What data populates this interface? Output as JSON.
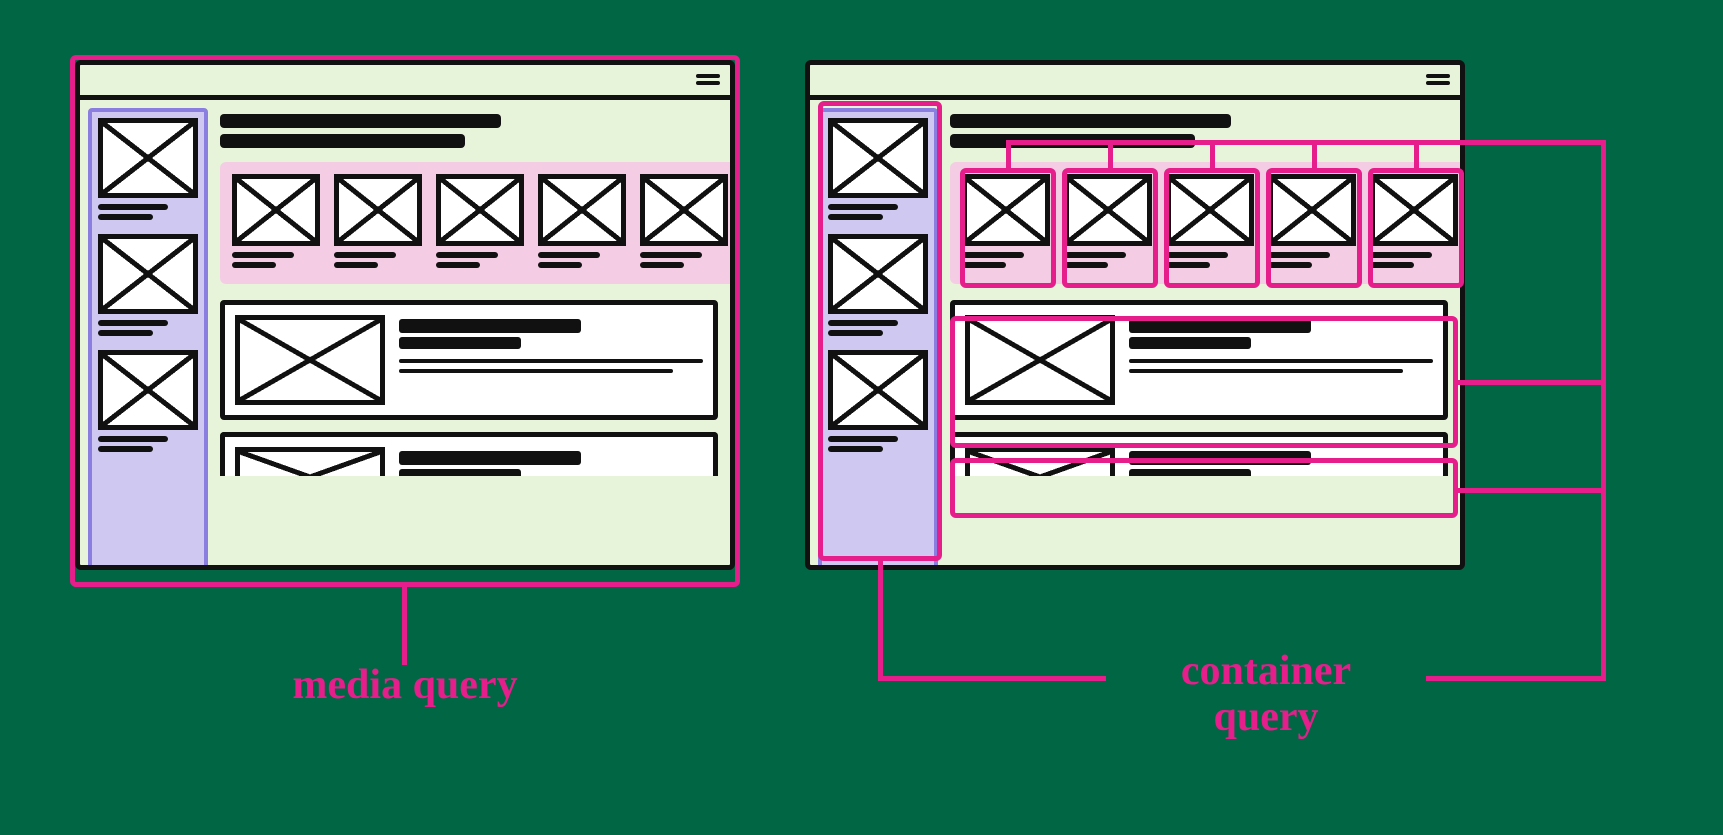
{
  "labels": {
    "left": "media query",
    "right_line1": "container",
    "right_line2": "query"
  },
  "colors": {
    "background": "#006644",
    "highlight": "#e61e8c",
    "panel_bg": "#e7f4d9",
    "sidebar_bg": "#cfc8f0",
    "sidebar_border": "#8a7fe0",
    "carousel_bg": "#f4cde4",
    "ink": "#111111"
  },
  "structure": {
    "panels": [
      "media-query-example",
      "container-query-example"
    ],
    "sidebar_card_count": 3,
    "carousel_card_count": 5,
    "feature_rows": 2
  },
  "concept": {
    "left": "media query — highlight wraps the whole viewport",
    "right": "container query — highlights wrap each component container and its items"
  }
}
